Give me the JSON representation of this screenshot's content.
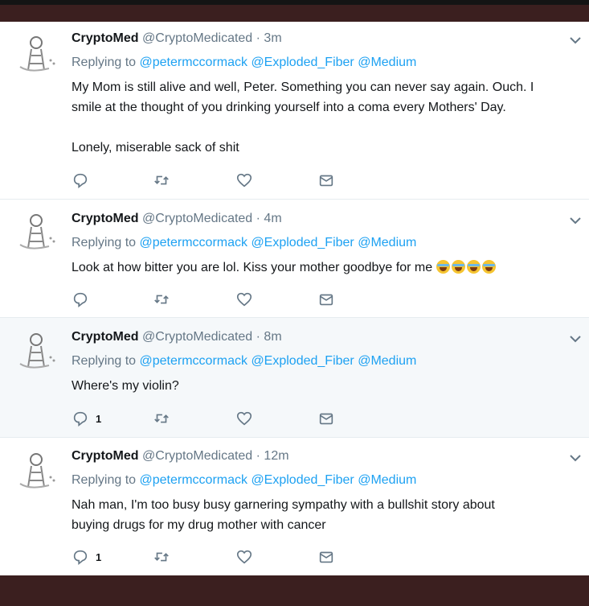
{
  "tweets": [
    {
      "name": "CryptoMed",
      "handle": "@CryptoMedicated",
      "time": "· 3m",
      "replying_prefix": "Replying to",
      "mentions": "@petermccormack @Exploded_Fiber @Medium",
      "text_lines": [
        "My Mom is still alive and well, Peter. Something you can never say again. Ouch. I",
        "smile at the thought of you drinking yourself into a coma every Mothers' Day.",
        "",
        "Lonely, miserable sack of shit"
      ],
      "reply_count": "",
      "icons": [
        "reply-icon",
        "retweet-icon",
        "like-icon",
        "dm-icon",
        "chevron-down-icon"
      ]
    },
    {
      "name": "CryptoMed",
      "handle": "@CryptoMedicated",
      "time": "· 4m",
      "replying_prefix": "Replying to",
      "mentions": "@petermccormack @Exploded_Fiber @Medium",
      "text_lines": [
        "Look at how bitter you are lol. Kiss your mother goodbye for me"
      ],
      "emoji": [
        "tears-of-joy-emoji",
        "tears-of-joy-emoji",
        "tears-of-joy-emoji",
        "tears-of-joy-emoji"
      ],
      "reply_count": ""
    },
    {
      "name": "CryptoMed",
      "handle": "@CryptoMedicated",
      "time": "· 8m",
      "replying_prefix": "Replying to",
      "mentions": "@petermccormack @Exploded_Fiber @Medium",
      "text_lines": [
        "Where's my violin?"
      ],
      "reply_count": "1"
    },
    {
      "name": "CryptoMed",
      "handle": "@CryptoMedicated",
      "time": "· 12m",
      "replying_prefix": "Replying to",
      "mentions": "@petermccormack @Exploded_Fiber @Medium",
      "text_lines": [
        "Nah man, I'm too busy busy garnering sympathy with a bullshit story about",
        "buying drugs for my drug mother with cancer"
      ],
      "reply_count": "1"
    }
  ],
  "colors": {
    "link": "#1da1f2",
    "secondary": "#657786",
    "primary_text": "#14171a",
    "frame": "#3b1f1f"
  }
}
